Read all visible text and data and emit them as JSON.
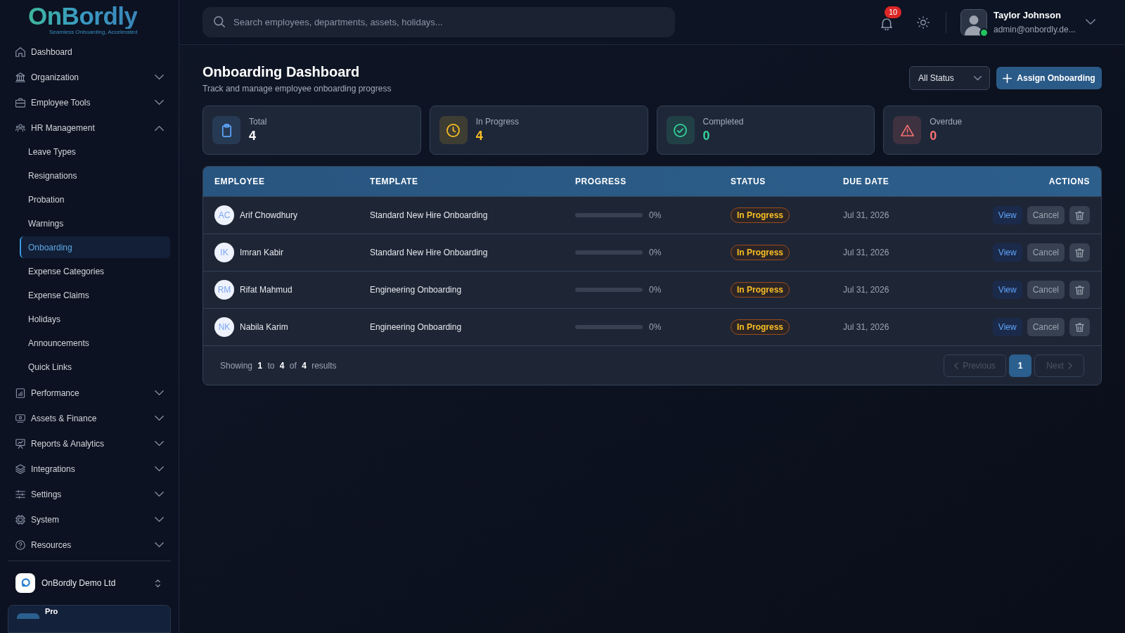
{
  "sidebar": {
    "logo": {
      "name": "OnBordly",
      "tagline": "Seamless Onboarding, Accelerated"
    },
    "items": [
      {
        "label": "Dashboard",
        "kind": "link",
        "selected": false
      },
      {
        "label": "Organization",
        "kind": "group",
        "selected": false,
        "expanded": false
      },
      {
        "label": "Employee Tools",
        "kind": "group",
        "selected": false,
        "expanded": false
      },
      {
        "label": "HR Management",
        "kind": "group",
        "selected": false,
        "expanded": true,
        "children": [
          {
            "label": "Leave Types",
            "selected": false
          },
          {
            "label": "Resignations",
            "selected": false
          },
          {
            "label": "Probation",
            "selected": false
          },
          {
            "label": "Warnings",
            "selected": false
          },
          {
            "label": "Onboarding",
            "selected": true
          },
          {
            "label": "Expense Categories",
            "selected": false
          },
          {
            "label": "Expense Claims",
            "selected": false
          },
          {
            "label": "Holidays",
            "selected": false
          },
          {
            "label": "Announcements",
            "selected": false
          },
          {
            "label": "Quick Links",
            "selected": false
          }
        ]
      },
      {
        "label": "Performance",
        "kind": "group",
        "selected": false,
        "expanded": false
      },
      {
        "label": "Assets & Finance",
        "kind": "group",
        "selected": false,
        "expanded": false
      },
      {
        "label": "Reports & Analytics",
        "kind": "group",
        "selected": false,
        "expanded": false
      },
      {
        "label": "Integrations",
        "kind": "group",
        "selected": false,
        "expanded": false
      },
      {
        "label": "Settings",
        "kind": "group",
        "selected": false,
        "expanded": false
      },
      {
        "label": "System",
        "kind": "group",
        "selected": false,
        "expanded": false
      },
      {
        "label": "Resources",
        "kind": "group",
        "selected": false,
        "expanded": false
      }
    ],
    "organization": {
      "name": "OnBordly Demo Ltd"
    },
    "plan": {
      "label": "Pro"
    }
  },
  "header": {
    "search": {
      "placeholder": "Search employees, departments, assets, holidays..."
    },
    "notifications": {
      "count": "10"
    },
    "user": {
      "name": "Taylor Johnson",
      "email": "admin@onbordly.de...",
      "online": true
    }
  },
  "page": {
    "title": "Onboarding Dashboard",
    "subtitle": "Track and manage employee onboarding progress",
    "status_filter": {
      "value": "All Status"
    },
    "assign_button": {
      "label": "Assign Onboarding"
    }
  },
  "stats": [
    {
      "label": "Total",
      "value": "4",
      "kind": "total",
      "color": "#60a5fa"
    },
    {
      "label": "In Progress",
      "value": "4",
      "kind": "pending",
      "color": "#fbbf24"
    },
    {
      "label": "Completed",
      "value": "0",
      "kind": "done",
      "color": "#34d399"
    },
    {
      "label": "Overdue",
      "value": "0",
      "kind": "overdue",
      "color": "#f87171"
    }
  ],
  "table": {
    "columns": [
      {
        "label": "EMPLOYEE"
      },
      {
        "label": "TEMPLATE"
      },
      {
        "label": "PROGRESS"
      },
      {
        "label": "STATUS"
      },
      {
        "label": "DUE DATE"
      },
      {
        "label": "ACTIONS"
      }
    ],
    "rows": [
      {
        "initials": "AC",
        "name": "Arif Chowdhury",
        "template": "Standard New Hire Onboarding",
        "progress": {
          "level": 0,
          "reading": "0%"
        },
        "status": "In Progress",
        "due_date": "Jul 31, 2026",
        "actions": {
          "view": "View",
          "cancel": "Cancel"
        }
      },
      {
        "initials": "IK",
        "name": "Imran Kabir",
        "template": "Standard New Hire Onboarding",
        "progress": {
          "level": 0,
          "reading": "0%"
        },
        "status": "In Progress",
        "due_date": "Jul 31, 2026",
        "actions": {
          "view": "View",
          "cancel": "Cancel"
        }
      },
      {
        "initials": "RM",
        "name": "Rifat Mahmud",
        "template": "Engineering Onboarding",
        "progress": {
          "level": 0,
          "reading": "0%"
        },
        "status": "In Progress",
        "due_date": "Jul 31, 2026",
        "actions": {
          "view": "View",
          "cancel": "Cancel"
        }
      },
      {
        "initials": "NK",
        "name": "Nabila Karim",
        "template": "Engineering Onboarding",
        "progress": {
          "level": 0,
          "reading": "0%"
        },
        "status": "In Progress",
        "due_date": "Jul 31, 2026",
        "actions": {
          "view": "View",
          "cancel": "Cancel"
        }
      }
    ],
    "summary": "Showing **1** to **4** of **4** results",
    "pagination": {
      "previous": {
        "label": "Previous",
        "disabled": true
      },
      "pages": [
        {
          "label": "1",
          "selected": true
        }
      ],
      "next": {
        "label": "Next",
        "disabled": true
      }
    }
  }
}
